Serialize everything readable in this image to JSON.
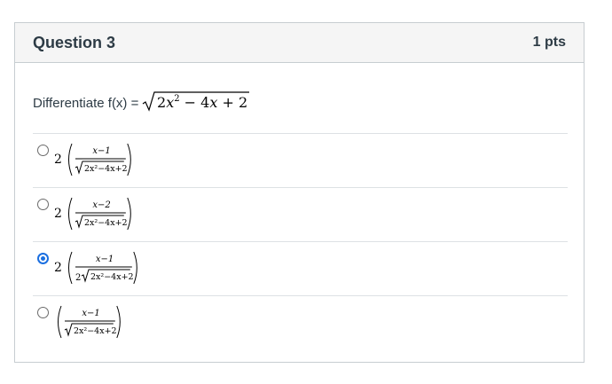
{
  "question": {
    "title": "Question 3",
    "points": "1 pts",
    "prompt_label": "Differentiate f(x) =",
    "prompt_expr": "√(2x² − 4x + 2)"
  },
  "answers": [
    {
      "coef": "2",
      "numerator": "x−1",
      "denom_coef": "",
      "denom_radicand": "2x²−4x+2",
      "selected": false
    },
    {
      "coef": "2",
      "numerator": "x−2",
      "denom_coef": "",
      "denom_radicand": "2x²−4x+2",
      "selected": false
    },
    {
      "coef": "2",
      "numerator": "x−1",
      "denom_coef": "2",
      "denom_radicand": "2x²−4x+2",
      "selected": true
    },
    {
      "coef": "",
      "numerator": "x−1",
      "denom_coef": "",
      "denom_radicand": "2x²−4x+2",
      "selected": false
    }
  ],
  "colors": {
    "accent": "#1b6fe0",
    "header_bg": "#f5f5f5",
    "border": "#c7cdd1"
  }
}
